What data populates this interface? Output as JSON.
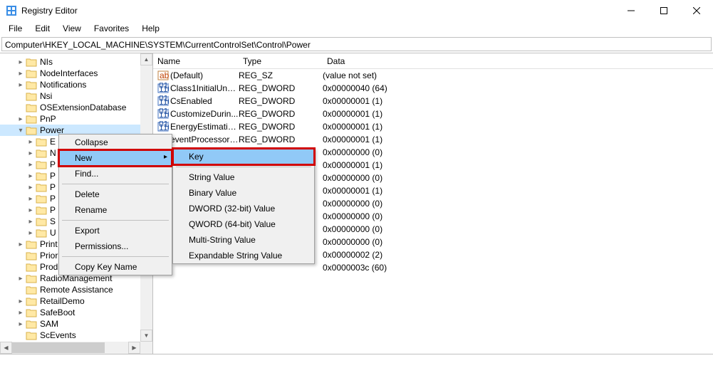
{
  "window": {
    "title": "Registry Editor"
  },
  "menubar": [
    "File",
    "Edit",
    "View",
    "Favorites",
    "Help"
  ],
  "addressbar": "Computer\\HKEY_LOCAL_MACHINE\\SYSTEM\\CurrentControlSet\\Control\\Power",
  "tree": {
    "items": [
      {
        "label": "NIs",
        "indent": 1,
        "twisty": "closed"
      },
      {
        "label": "NodeInterfaces",
        "indent": 1,
        "twisty": "closed"
      },
      {
        "label": "Notifications",
        "indent": 1,
        "twisty": "closed"
      },
      {
        "label": "Nsi",
        "indent": 1,
        "twisty": "none"
      },
      {
        "label": "OSExtensionDatabase",
        "indent": 1,
        "twisty": "none"
      },
      {
        "label": "PnP",
        "indent": 1,
        "twisty": "closed"
      },
      {
        "label": "Power",
        "indent": 1,
        "twisty": "open",
        "selected": true
      },
      {
        "label": "E",
        "indent": 2,
        "twisty": "closed"
      },
      {
        "label": "N",
        "indent": 2,
        "twisty": "closed"
      },
      {
        "label": "P",
        "indent": 2,
        "twisty": "closed"
      },
      {
        "label": "P",
        "indent": 2,
        "twisty": "closed"
      },
      {
        "label": "P",
        "indent": 2,
        "twisty": "closed"
      },
      {
        "label": "P",
        "indent": 2,
        "twisty": "closed"
      },
      {
        "label": "P",
        "indent": 2,
        "twisty": "closed"
      },
      {
        "label": "S",
        "indent": 2,
        "twisty": "closed"
      },
      {
        "label": "U",
        "indent": 2,
        "twisty": "closed"
      },
      {
        "label": "Print",
        "indent": 1,
        "twisty": "closed"
      },
      {
        "label": "PriorityControl",
        "indent": 1,
        "twisty": "none"
      },
      {
        "label": "ProductOptions",
        "indent": 1,
        "twisty": "none"
      },
      {
        "label": "RadioManagement",
        "indent": 1,
        "twisty": "closed"
      },
      {
        "label": "Remote Assistance",
        "indent": 1,
        "twisty": "none"
      },
      {
        "label": "RetailDemo",
        "indent": 1,
        "twisty": "closed"
      },
      {
        "label": "SafeBoot",
        "indent": 1,
        "twisty": "closed"
      },
      {
        "label": "SAM",
        "indent": 1,
        "twisty": "closed"
      },
      {
        "label": "ScEvents",
        "indent": 1,
        "twisty": "none"
      }
    ]
  },
  "columns": {
    "name": "Name",
    "type": "Type",
    "data": "Data"
  },
  "values": [
    {
      "icon": "str",
      "name": "(Default)",
      "type": "REG_SZ",
      "data": "(value not set)"
    },
    {
      "icon": "bin",
      "name": "Class1InitialUnp...",
      "type": "REG_DWORD",
      "data": "0x00000040 (64)"
    },
    {
      "icon": "bin",
      "name": "CsEnabled",
      "type": "REG_DWORD",
      "data": "0x00000001 (1)"
    },
    {
      "icon": "bin",
      "name": "CustomizeDurin...",
      "type": "REG_DWORD",
      "data": "0x00000001 (1)"
    },
    {
      "icon": "bin",
      "name": "EnergyEstimatio...",
      "type": "REG_DWORD",
      "data": "0x00000001 (1)"
    },
    {
      "icon": "bin",
      "name": "eventProcessorE...",
      "type": "REG_DWORD",
      "data": "0x00000001 (1)"
    },
    {
      "icon": "blank",
      "name": "",
      "type": "",
      "data": "0x00000000 (0)"
    },
    {
      "icon": "blank",
      "name": "",
      "type": "",
      "data": "0x00000001 (1)"
    },
    {
      "icon": "blank",
      "name": "",
      "type": "",
      "data": "0x00000000 (0)"
    },
    {
      "icon": "blank",
      "name": "",
      "type": "",
      "data": "0x00000001 (1)"
    },
    {
      "icon": "blank",
      "name": "",
      "type": "",
      "data": "0x00000000 (0)"
    },
    {
      "icon": "blank",
      "name": "",
      "type": "",
      "data": "0x00000000 (0)"
    },
    {
      "icon": "blank",
      "name": "",
      "type": "",
      "data": "0x00000000 (0)"
    },
    {
      "icon": "blank",
      "name": "",
      "type": "",
      "data": "0x00000000 (0)"
    },
    {
      "icon": "blank",
      "name": "",
      "type": "",
      "data": "0x00000002 (2)"
    },
    {
      "icon": "blank",
      "name": "",
      "type": "",
      "data": "0x0000003c (60)"
    }
  ],
  "context1": {
    "items": [
      {
        "label": "Collapse"
      },
      {
        "label": "New",
        "hover": true,
        "hasfly": true,
        "highlight": true
      },
      {
        "label": "Find..."
      },
      {
        "sep": true
      },
      {
        "label": "Delete"
      },
      {
        "label": "Rename"
      },
      {
        "sep": true
      },
      {
        "label": "Export"
      },
      {
        "label": "Permissions..."
      },
      {
        "sep": true
      },
      {
        "label": "Copy Key Name"
      }
    ]
  },
  "context2": {
    "items": [
      {
        "label": "Key",
        "hover": true,
        "highlight": true
      },
      {
        "sep": true
      },
      {
        "label": "String Value"
      },
      {
        "label": "Binary Value"
      },
      {
        "label": "DWORD (32-bit) Value"
      },
      {
        "label": "QWORD (64-bit) Value"
      },
      {
        "label": "Multi-String Value"
      },
      {
        "label": "Expandable String Value"
      }
    ]
  }
}
